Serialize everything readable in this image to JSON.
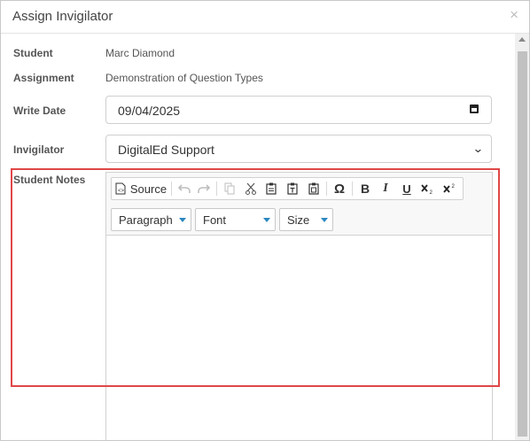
{
  "dialog": {
    "title": "Assign Invigilator",
    "close_symbol": "×"
  },
  "form": {
    "student_label": "Student",
    "student_value": "Marc Diamond",
    "assignment_label": "Assignment",
    "assignment_value": "Demonstration of Question Types",
    "write_date_label": "Write Date",
    "write_date_value": "09/04/2025",
    "invigilator_label": "Invigilator",
    "invigilator_value": "DigitalEd Support",
    "notes_label": "Student Notes"
  },
  "editor": {
    "source_label": "Source",
    "paragraph_label": "Paragraph",
    "font_label": "Font",
    "size_label": "Size",
    "omega_symbol": "Ω",
    "bold_symbol": "B",
    "italic_symbol": "I",
    "underline_symbol": "U"
  },
  "colors": {
    "highlight": "#e04646",
    "dropdown_arrow": "#2b87c0"
  }
}
